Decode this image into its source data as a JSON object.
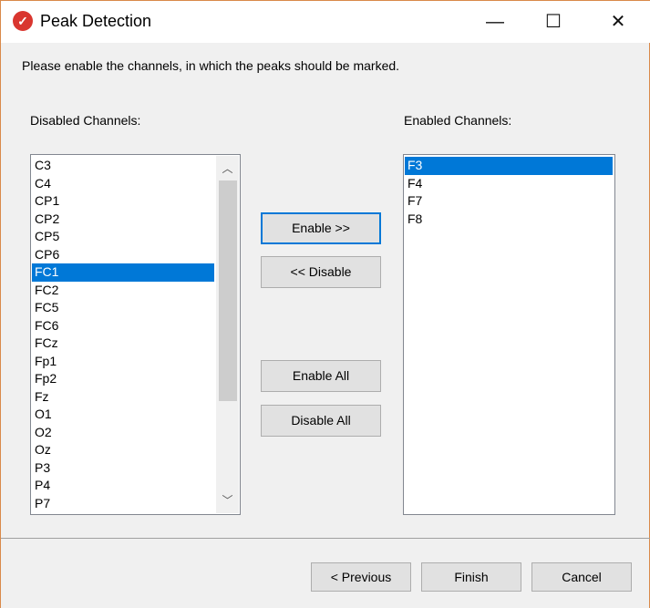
{
  "window": {
    "title": "Peak Detection",
    "controls": [
      "minimize",
      "maximize",
      "close"
    ]
  },
  "instruction": "Please enable the channels, in which the peaks should be marked.",
  "disabled": {
    "label": "Disabled Channels:",
    "items": [
      "C3",
      "C4",
      "CP1",
      "CP2",
      "CP5",
      "CP6",
      "FC1",
      "FC2",
      "FC5",
      "FC6",
      "FCz",
      "Fp1",
      "Fp2",
      "Fz",
      "O1",
      "O2",
      "Oz",
      "P3",
      "P4",
      "P7"
    ],
    "selected": "FC1"
  },
  "enabled": {
    "label": "Enabled Channels:",
    "items": [
      "F3",
      "F4",
      "F7",
      "F8"
    ],
    "selected": "F3"
  },
  "buttons": {
    "enable": "Enable >>",
    "disable": "<< Disable",
    "enable_all": "Enable All",
    "disable_all": "Disable All",
    "previous": "< Previous",
    "finish": "Finish",
    "cancel": "Cancel"
  },
  "colors": {
    "selection": "#0078d7",
    "focus_border": "#0078d7"
  }
}
